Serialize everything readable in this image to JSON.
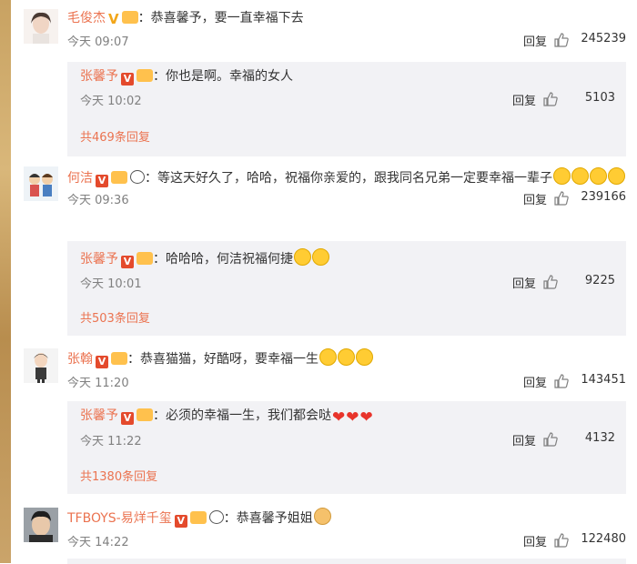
{
  "comments": [
    {
      "username": "毛俊杰",
      "text": "恭喜馨予，要一直幸福下去",
      "time": "今天 09:07",
      "reply": "回复",
      "likes": "245239",
      "sub": {
        "username": "张馨予",
        "text": "你也是啊。幸福的女人",
        "time": "今天 10:02",
        "reply": "回复",
        "likes": "5103"
      },
      "more": "共469条回复"
    },
    {
      "username": "何洁",
      "text": "等这天好久了，哈哈，祝福你亲爱的，跟我同名兄弟一定要幸福一辈子",
      "time": "今天 09:36",
      "reply": "回复",
      "likes": "239166",
      "sub": {
        "username": "张馨予",
        "text": "哈哈哈，何洁祝福何捷",
        "time": "今天 10:01",
        "reply": "回复",
        "likes": "9225"
      },
      "more": "共503条回复"
    },
    {
      "username": "张翰",
      "text": "恭喜猫猫，好酷呀，要幸福一生",
      "time": "今天 11:20",
      "reply": "回复",
      "likes": "143451",
      "sub": {
        "username": "张馨予",
        "text": "必须的幸福一生，我们都会哒",
        "time": "今天 11:22",
        "reply": "回复",
        "likes": "4132"
      },
      "more": "共1380条回复"
    },
    {
      "username": "TFBOYS-易烊千玺",
      "text": "恭喜馨予姐姐",
      "time": "今天 14:22",
      "reply": "回复",
      "likes": "122480"
    }
  ],
  "colors": {
    "username": "#eb7350",
    "subBackground": "#f2f2f5",
    "meta": "#808080"
  },
  "icons": [
    "verified-v-icon",
    "vip-crown-icon",
    "panda-icon",
    "smile-emoji-icon",
    "heart-emoji-icon",
    "clap-emoji-icon",
    "thumb-up-icon"
  ]
}
